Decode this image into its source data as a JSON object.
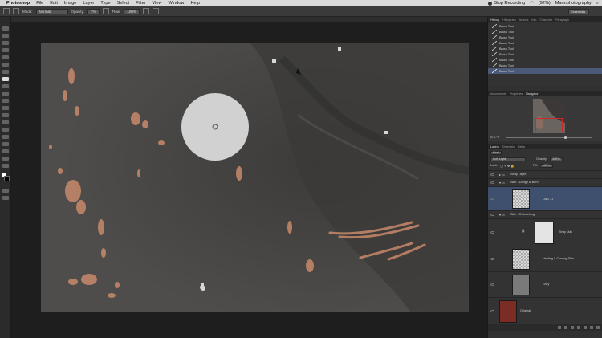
{
  "menubar": {
    "app": "Photoshop",
    "menus": [
      "File",
      "Edit",
      "Image",
      "Layer",
      "Type",
      "Select",
      "Filter",
      "View",
      "Window",
      "Help"
    ],
    "recording": "Stop Recording",
    "battery": "(92%)",
    "user": "Mannphotography"
  },
  "options": {
    "mode_label": "Mode:",
    "mode_value": "Normal",
    "opacity_label": "Opacity:",
    "opacity_value": "7%",
    "flow_label": "Flow:",
    "flow_value": "100%",
    "workspace": "Essentials"
  },
  "history": {
    "tabs": [
      "History",
      "Histogram",
      "Actions",
      "Info",
      "Character",
      "Paragraph"
    ],
    "items": [
      "Brush Tool",
      "Brush Tool",
      "Brush Tool",
      "Brush Tool",
      "Brush Tool",
      "Brush Tool",
      "Brush Tool",
      "Brush Tool",
      "Brush Tool"
    ]
  },
  "navigator": {
    "tabs": [
      "Adjustments",
      "Properties",
      "Navigator"
    ],
    "zoom": "66.67%"
  },
  "layers": {
    "tabs": [
      "Layers",
      "Channels",
      "Paths"
    ],
    "kind": "Kind",
    "blend_mode": "Soft Light",
    "opacity_label": "Opacity:",
    "opacity_value": "100%",
    "lock_label": "Lock:",
    "fill_label": "Fill:",
    "fill_value": "100%",
    "items": [
      {
        "name": "Stray Layer"
      },
      {
        "name": "Skin - Dodge & Burn"
      },
      {
        "name": "D&B - 1"
      },
      {
        "name": "Skin - Retouching"
      },
      {
        "name": "Stray skin"
      },
      {
        "name": "Healing & Cloning Skin"
      },
      {
        "name": "Grey"
      },
      {
        "name": "Original"
      }
    ]
  },
  "colors": {
    "canvas": "#4e4d4b",
    "selection": "#3f4f6e",
    "highlight_dots": "#c8896b"
  }
}
